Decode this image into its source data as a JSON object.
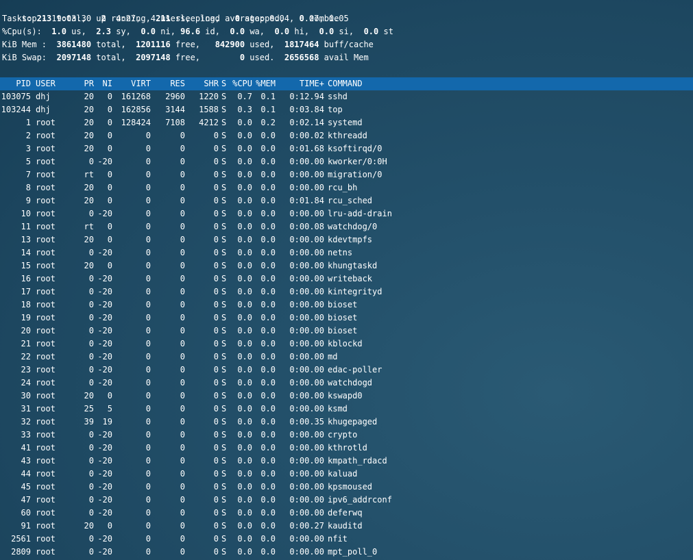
{
  "summary": {
    "line1": {
      "prefix": "top - 19:03:30 up  4:27,  4 users,  load average: 0.04, 0.07, 0.05"
    },
    "tasks": {
      "label": "Tasks:",
      "total": "213",
      "total_label": "total,",
      "running": "2",
      "running_label": "running,",
      "sleeping": "211",
      "sleeping_label": "sleeping,",
      "stopped": "0",
      "stopped_label": "stopped,",
      "zombie": "0",
      "zombie_label": "zombie"
    },
    "cpu": {
      "label": "%Cpu(s):",
      "us": "1.0",
      "sy": "2.3",
      "ni": "0.0",
      "id": "96.6",
      "wa": "0.0",
      "hi": "0.0",
      "si": "0.0",
      "st": "0.0"
    },
    "mem": {
      "label": "KiB Mem :",
      "total": "3861480",
      "free": "1201116",
      "used": "842900",
      "buff_cache": "1817464"
    },
    "swap": {
      "label": "KiB Swap:",
      "total": "2097148",
      "free": "2097148",
      "used": "0",
      "avail": "2656568"
    }
  },
  "columns": [
    "PID",
    "USER",
    "PR",
    "NI",
    "VIRT",
    "RES",
    "SHR",
    "S",
    "%CPU",
    "%MEM",
    "TIME+",
    "COMMAND"
  ],
  "processes": [
    [
      "103075",
      "dhj",
      "20",
      "0",
      "161268",
      "2960",
      "1220",
      "S",
      "0.7",
      "0.1",
      "0:12.94",
      "sshd"
    ],
    [
      "103244",
      "dhj",
      "20",
      "0",
      "162856",
      "3144",
      "1588",
      "S",
      "0.3",
      "0.1",
      "0:03.84",
      "top"
    ],
    [
      "1",
      "root",
      "20",
      "0",
      "128424",
      "7108",
      "4212",
      "S",
      "0.0",
      "0.2",
      "0:02.14",
      "systemd"
    ],
    [
      "2",
      "root",
      "20",
      "0",
      "0",
      "0",
      "0",
      "S",
      "0.0",
      "0.0",
      "0:00.02",
      "kthreadd"
    ],
    [
      "3",
      "root",
      "20",
      "0",
      "0",
      "0",
      "0",
      "S",
      "0.0",
      "0.0",
      "0:01.68",
      "ksoftirqd/0"
    ],
    [
      "5",
      "root",
      "0",
      "-20",
      "0",
      "0",
      "0",
      "S",
      "0.0",
      "0.0",
      "0:00.00",
      "kworker/0:0H"
    ],
    [
      "7",
      "root",
      "rt",
      "0",
      "0",
      "0",
      "0",
      "S",
      "0.0",
      "0.0",
      "0:00.00",
      "migration/0"
    ],
    [
      "8",
      "root",
      "20",
      "0",
      "0",
      "0",
      "0",
      "S",
      "0.0",
      "0.0",
      "0:00.00",
      "rcu_bh"
    ],
    [
      "9",
      "root",
      "20",
      "0",
      "0",
      "0",
      "0",
      "S",
      "0.0",
      "0.0",
      "0:01.84",
      "rcu_sched"
    ],
    [
      "10",
      "root",
      "0",
      "-20",
      "0",
      "0",
      "0",
      "S",
      "0.0",
      "0.0",
      "0:00.00",
      "lru-add-drain"
    ],
    [
      "11",
      "root",
      "rt",
      "0",
      "0",
      "0",
      "0",
      "S",
      "0.0",
      "0.0",
      "0:00.08",
      "watchdog/0"
    ],
    [
      "13",
      "root",
      "20",
      "0",
      "0",
      "0",
      "0",
      "S",
      "0.0",
      "0.0",
      "0:00.00",
      "kdevtmpfs"
    ],
    [
      "14",
      "root",
      "0",
      "-20",
      "0",
      "0",
      "0",
      "S",
      "0.0",
      "0.0",
      "0:00.00",
      "netns"
    ],
    [
      "15",
      "root",
      "20",
      "0",
      "0",
      "0",
      "0",
      "S",
      "0.0",
      "0.0",
      "0:00.00",
      "khungtaskd"
    ],
    [
      "16",
      "root",
      "0",
      "-20",
      "0",
      "0",
      "0",
      "S",
      "0.0",
      "0.0",
      "0:00.00",
      "writeback"
    ],
    [
      "17",
      "root",
      "0",
      "-20",
      "0",
      "0",
      "0",
      "S",
      "0.0",
      "0.0",
      "0:00.00",
      "kintegrityd"
    ],
    [
      "18",
      "root",
      "0",
      "-20",
      "0",
      "0",
      "0",
      "S",
      "0.0",
      "0.0",
      "0:00.00",
      "bioset"
    ],
    [
      "19",
      "root",
      "0",
      "-20",
      "0",
      "0",
      "0",
      "S",
      "0.0",
      "0.0",
      "0:00.00",
      "bioset"
    ],
    [
      "20",
      "root",
      "0",
      "-20",
      "0",
      "0",
      "0",
      "S",
      "0.0",
      "0.0",
      "0:00.00",
      "bioset"
    ],
    [
      "21",
      "root",
      "0",
      "-20",
      "0",
      "0",
      "0",
      "S",
      "0.0",
      "0.0",
      "0:00.00",
      "kblockd"
    ],
    [
      "22",
      "root",
      "0",
      "-20",
      "0",
      "0",
      "0",
      "S",
      "0.0",
      "0.0",
      "0:00.00",
      "md"
    ],
    [
      "23",
      "root",
      "0",
      "-20",
      "0",
      "0",
      "0",
      "S",
      "0.0",
      "0.0",
      "0:00.00",
      "edac-poller"
    ],
    [
      "24",
      "root",
      "0",
      "-20",
      "0",
      "0",
      "0",
      "S",
      "0.0",
      "0.0",
      "0:00.00",
      "watchdogd"
    ],
    [
      "30",
      "root",
      "20",
      "0",
      "0",
      "0",
      "0",
      "S",
      "0.0",
      "0.0",
      "0:00.00",
      "kswapd0"
    ],
    [
      "31",
      "root",
      "25",
      "5",
      "0",
      "0",
      "0",
      "S",
      "0.0",
      "0.0",
      "0:00.00",
      "ksmd"
    ],
    [
      "32",
      "root",
      "39",
      "19",
      "0",
      "0",
      "0",
      "S",
      "0.0",
      "0.0",
      "0:00.35",
      "khugepaged"
    ],
    [
      "33",
      "root",
      "0",
      "-20",
      "0",
      "0",
      "0",
      "S",
      "0.0",
      "0.0",
      "0:00.00",
      "crypto"
    ],
    [
      "41",
      "root",
      "0",
      "-20",
      "0",
      "0",
      "0",
      "S",
      "0.0",
      "0.0",
      "0:00.00",
      "kthrotld"
    ],
    [
      "43",
      "root",
      "0",
      "-20",
      "0",
      "0",
      "0",
      "S",
      "0.0",
      "0.0",
      "0:00.00",
      "kmpath_rdacd"
    ],
    [
      "44",
      "root",
      "0",
      "-20",
      "0",
      "0",
      "0",
      "S",
      "0.0",
      "0.0",
      "0:00.00",
      "kaluad"
    ],
    [
      "45",
      "root",
      "0",
      "-20",
      "0",
      "0",
      "0",
      "S",
      "0.0",
      "0.0",
      "0:00.00",
      "kpsmoused"
    ],
    [
      "47",
      "root",
      "0",
      "-20",
      "0",
      "0",
      "0",
      "S",
      "0.0",
      "0.0",
      "0:00.00",
      "ipv6_addrconf"
    ],
    [
      "60",
      "root",
      "0",
      "-20",
      "0",
      "0",
      "0",
      "S",
      "0.0",
      "0.0",
      "0:00.00",
      "deferwq"
    ],
    [
      "91",
      "root",
      "20",
      "0",
      "0",
      "0",
      "0",
      "S",
      "0.0",
      "0.0",
      "0:00.27",
      "kauditd"
    ],
    [
      "2561",
      "root",
      "0",
      "-20",
      "0",
      "0",
      "0",
      "S",
      "0.0",
      "0.0",
      "0:00.00",
      "nfit"
    ],
    [
      "2809",
      "root",
      "0",
      "-20",
      "0",
      "0",
      "0",
      "S",
      "0.0",
      "0.0",
      "0:00.00",
      "mpt_poll_0"
    ]
  ],
  "colors": {
    "background": "#1d4760",
    "header_bar": "#1368ac",
    "text": "#ffffff"
  }
}
